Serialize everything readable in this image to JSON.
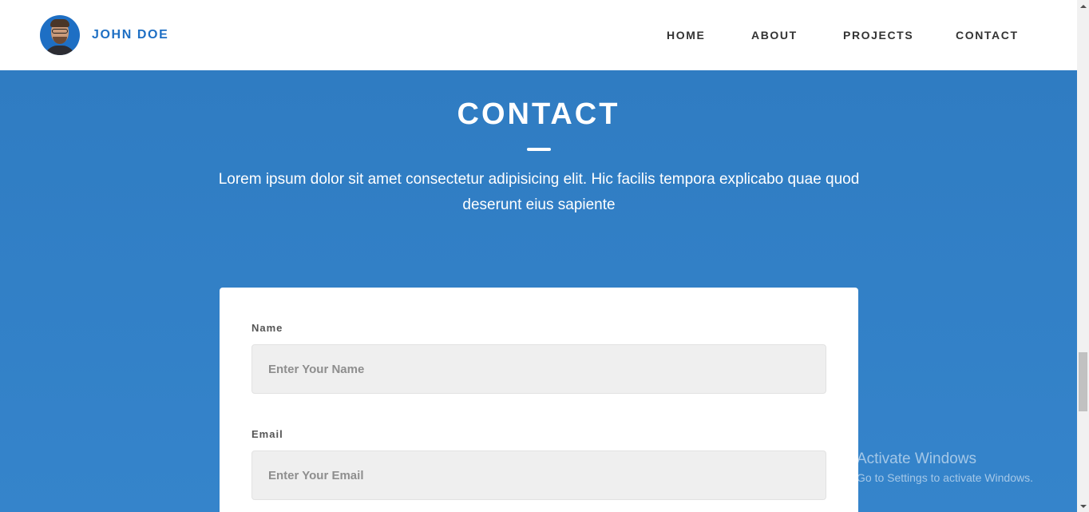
{
  "header": {
    "brand_name": "JOHN DOE",
    "nav": [
      {
        "label": "HOME"
      },
      {
        "label": "ABOUT"
      },
      {
        "label": "PROJECTS"
      },
      {
        "label": "CONTACT"
      }
    ]
  },
  "contact": {
    "title": "CONTACT",
    "description": "Lorem ipsum dolor sit amet consectetur adipisicing elit. Hic facilis tempora explicabo quae quod deserunt eius sapiente",
    "fields": {
      "name": {
        "label": "Name",
        "placeholder": "Enter Your Name",
        "value": ""
      },
      "email": {
        "label": "Email",
        "placeholder": "Enter Your Email",
        "value": ""
      }
    }
  },
  "watermark": {
    "title": "Activate Windows",
    "subtitle": "Go to Settings to activate Windows."
  },
  "colors": {
    "brand_blue": "#1e6fc4",
    "hero_blue": "#3180c6",
    "input_bg": "#efefef"
  }
}
